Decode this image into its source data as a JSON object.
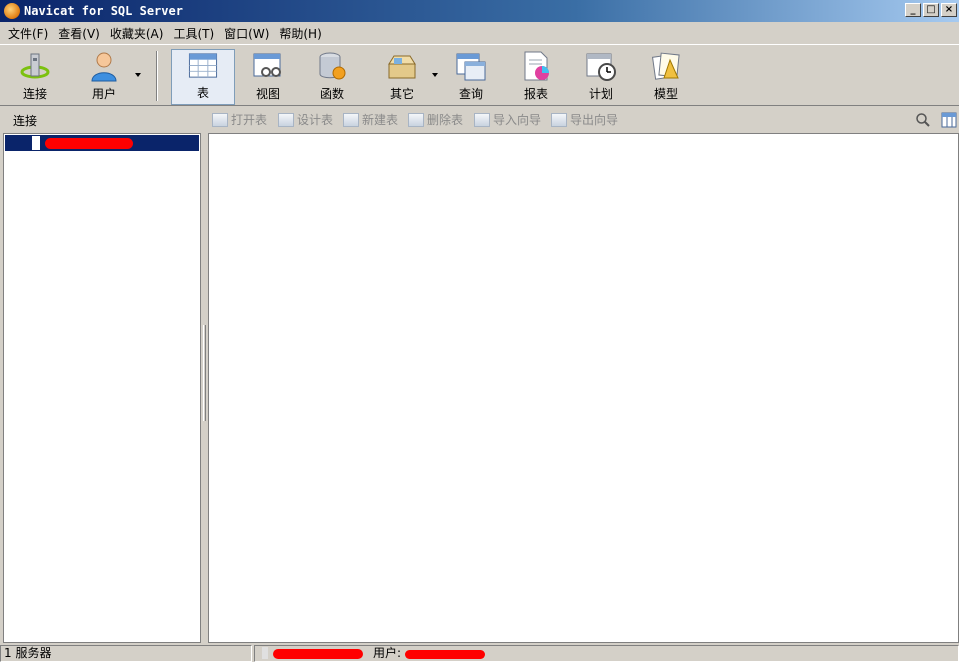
{
  "window": {
    "title": "Navicat for SQL Server",
    "controls": [
      "_",
      "□",
      "×"
    ]
  },
  "menu": [
    "文件(F)",
    "查看(V)",
    "收藏夹(A)",
    "工具(T)",
    "窗口(W)",
    "帮助(H)"
  ],
  "toolbar": {
    "connect": "连接",
    "user": "用户",
    "table": "表",
    "view": "视图",
    "function": "函数",
    "other": "其它",
    "query": "查询",
    "report": "报表",
    "schedule": "计划",
    "model": "模型"
  },
  "subbar": {
    "section": "连接",
    "actions": [
      "打开表",
      "设计表",
      "新建表",
      "删除表",
      "导入向导",
      "导出向导"
    ]
  },
  "status": {
    "count": "1 服务器",
    "user_label": "用户:"
  },
  "colors": {
    "selection": "#0a246a",
    "window_bg": "#d4d0c8"
  }
}
